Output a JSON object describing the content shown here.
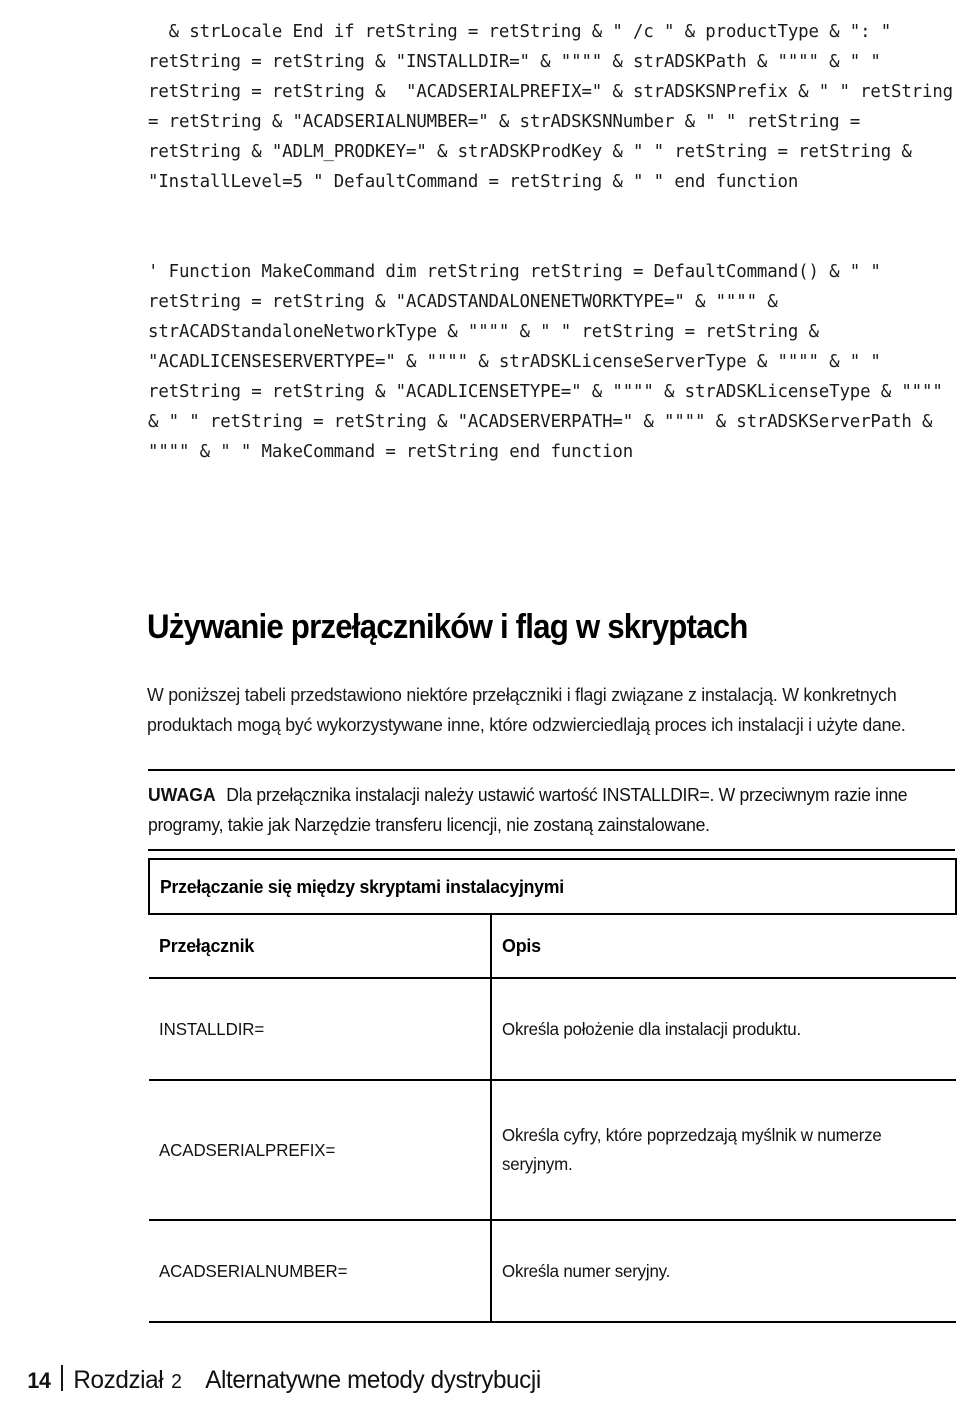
{
  "document": {
    "language": "pl",
    "code_blocks": [
      {
        "id": "code-block-1",
        "text": "  & strLocale End if retString = retString & \" /c \" & productType & \": \" retString = retString & \"INSTALLDIR=\" & \"\"\"\" & strADSKPath & \"\"\"\" & \" \" retString = retString &  \"ACADSERIALPREFIX=\" & strADSKSNPrefix & \" \" retString = retString & \"ACADSERIALNUMBER=\" & strADSKSNNumber & \" \" retString = retString & \"ADLM_PRODKEY=\" & strADSKProdKey & \" \" retString = retString & \"InstallLevel=5 \" DefaultCommand = retString & \" \" end function"
      },
      {
        "id": "code-block-2",
        "text": "' Function MakeCommand dim retString retString = DefaultCommand() & \" \" retString = retString & \"ACADSTANDALONENETWORKTYPE=\" & \"\"\"\" & strACADStandaloneNetworkType & \"\"\"\" & \" \" retString = retString & \"ACADLICENSESERVERTYPE=\" & \"\"\"\" & strADSKLicenseServerType & \"\"\"\" & \" \" retString = retString & \"ACADLICENSETYPE=\" & \"\"\"\" & strADSKLicenseType & \"\"\"\" & \" \" retString = retString & \"ACADSERVERPATH=\" & \"\"\"\" & strADSKServerPath & \"\"\"\" & \" \" MakeCommand = retString end function"
      }
    ],
    "heading": "Używanie przełączników i flag w skryptach",
    "paragraph": "W poniższej tabeli przedstawiono niektóre przełączniki i flagi związane z instalacją. W konkretnych produktach mogą być wykorzystywane inne, które odzwierciedlają proces ich instalacji i użyte dane.",
    "note": {
      "label": "UWAGA",
      "text": "Dla przełącznika instalacji należy ustawić wartość INSTALLDIR=. W przeciwnym razie inne programy, takie jak Narzędzie transferu licencji, nie zostaną zainstalowane."
    },
    "table": {
      "caption": "Przełączanie się między skryptami instalacyjnymi",
      "headers": [
        "Przełącznik",
        "Opis"
      ],
      "rows": [
        {
          "switch": "INSTALLDIR=",
          "description": "Określa położenie dla instalacji produktu."
        },
        {
          "switch": "ACADSERIALPREFIX=",
          "description": "Określa cyfry, które poprzedzają myślnik w numerze seryjnym."
        },
        {
          "switch": "ACADSERIALNUMBER=",
          "description": "Określa numer seryjny."
        }
      ]
    },
    "footer": {
      "page_number": "14",
      "chapter_word": "Rozdział",
      "chapter_number": "2",
      "chapter_title": "Alternatywne metody dystrybucji"
    }
  }
}
